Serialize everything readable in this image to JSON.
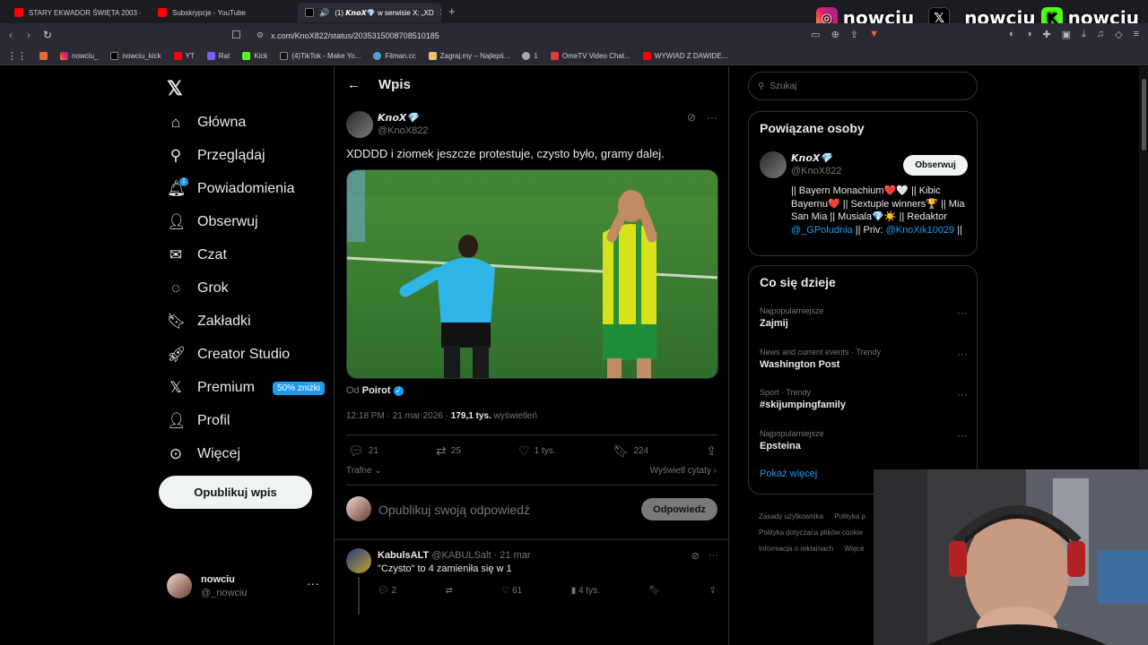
{
  "browser": {
    "tabs": [
      {
        "label": "STARY EKWADOR ŚWIĘTA 2003 ·"
      },
      {
        "label": "Subskrypcje - YouTube"
      },
      {
        "label": "(1) 𝙆𝙣𝙤𝙓💎 w serwisie X: „XD"
      }
    ],
    "new_tab": "+",
    "url": "x.com/KnoX822/status/2035315008708510185",
    "bookmarks": [
      "nowciu_",
      "nowciu_kick",
      "YT",
      "Rat",
      "Kick",
      "(4)TikTok - Make Yo...",
      "Filman.cc",
      "Zagraj.my – Najlepś...",
      "1",
      "OmeTV Video Chat...",
      "WYWIAD Z DAWIDE..."
    ]
  },
  "overlay": {
    "instagram": "nowciu_",
    "x": "_nowciu",
    "kick": "nowciu"
  },
  "nav": {
    "items": [
      "Główna",
      "Przeglądaj",
      "Powiadomienia",
      "Obserwuj",
      "Czat",
      "Grok",
      "Zakładki",
      "Creator Studio",
      "Premium",
      "Profil",
      "Więcej"
    ],
    "premium_badge": "50% zniżki",
    "notif_count": "1",
    "post_button": "Opublikuj wpis",
    "user_name": "nowciu",
    "user_handle": "@_nowciu"
  },
  "main": {
    "header": "Wpis",
    "author_name": "𝙆𝙣𝙤𝙓💎",
    "author_handle": "@KnoX822",
    "text": "XDDDD i ziomek jeszcze protestuje, czysto było, gramy dalej.",
    "from_prefix": "Od",
    "from_name": "Poirot",
    "time": "12:18 PM · 21 mar 2026 ·",
    "views": "179,1 tys.",
    "views_label": "wyświetleń",
    "actions": {
      "replies": "21",
      "reposts": "25",
      "likes": "1 tys.",
      "bookmarks": "224"
    },
    "sort": "Trafne",
    "quotes": "Wyświetl cytaty",
    "reply_placeholder": "Opublikuj swoją odpowiedź",
    "reply_button": "Odpowiedz",
    "reply": {
      "name": "KabulsALT",
      "handle": "@KABULSalt · 21 mar",
      "text": "\"Czysto\" to 4 zamieniła się w 1",
      "replies": "2",
      "likes": "61",
      "views": "4 tys."
    }
  },
  "sidebar": {
    "search_placeholder": "Szukaj",
    "related_title": "Powiązane osoby",
    "person_name": "𝙆𝙣𝙤𝙓💎",
    "person_handle": "@KnoX822",
    "follow": "Obserwuj",
    "bio_1": "|| Bayern Monachium❤️🤍 || Kibic Bayernu❤️ || Sextuple winners🏆 || Mia San Mia || Musiala💎☀️ || Redaktor",
    "bio_link_1": "@_GPoludnia",
    "bio_2": "|| Priv:",
    "bio_link_2": "@KnoXik10029",
    "bio_3": "||",
    "trends_title": "Co się dzieje",
    "trends": [
      {
        "category": "Najpopularniejsze",
        "name": "Zajmij"
      },
      {
        "category": "News and current events · Trendy",
        "name": "Washington Post"
      },
      {
        "category": "Sport · Trendy",
        "name": "#skijumpingfamily"
      },
      {
        "category": "Najpopularniejsze",
        "name": "Epsteina"
      }
    ],
    "show_more": "Pokaż więcej",
    "footer": [
      "Zasady użytkownika",
      "Polityka p",
      "Polityka dotycząca plików cookie",
      "Informacja o reklamach",
      "Więce"
    ]
  },
  "colors": {
    "accent": "#1d9bf0",
    "background": "#000000",
    "muted": "#71767b"
  }
}
